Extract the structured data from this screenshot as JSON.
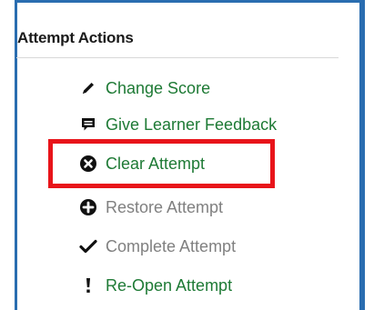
{
  "panel": {
    "title": "Attempt Actions"
  },
  "actions": [
    {
      "label": "Change Score",
      "icon": "pencil-icon",
      "enabled": true
    },
    {
      "label": "Give Learner Feedback",
      "icon": "comment-icon",
      "enabled": true
    },
    {
      "label": "Clear Attempt",
      "icon": "circle-x-icon",
      "enabled": true,
      "highlighted": true
    },
    {
      "label": "Restore Attempt",
      "icon": "circle-plus-icon",
      "enabled": false
    },
    {
      "label": "Complete Attempt",
      "icon": "checkmark-icon",
      "enabled": false
    },
    {
      "label": "Re-Open Attempt",
      "icon": "exclamation-icon",
      "enabled": true
    }
  ],
  "colors": {
    "frame_border": "#2a6db0",
    "enabled_link": "#1e7a35",
    "disabled_text": "#808080",
    "highlight": "#e8141a"
  }
}
